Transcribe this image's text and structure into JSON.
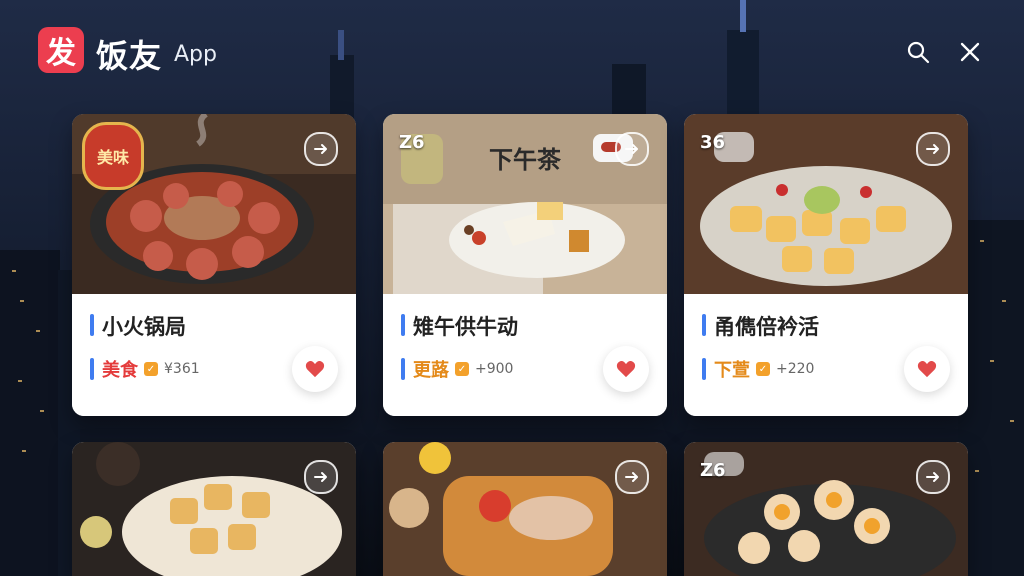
{
  "app": {
    "brand_badge": "发",
    "brand_name": "饭友",
    "brand_suffix": "App",
    "topbar_icons": [
      "search-icon",
      "close-icon"
    ]
  },
  "cards": [
    {
      "title": "小火锅局",
      "tag": "美食",
      "count": "¥361",
      "corner_label": "",
      "image_text": "美味",
      "overlay_title": ""
    },
    {
      "title": "雉午供牛动",
      "tag": "更蕗",
      "count": "+900",
      "corner_label": "Z6",
      "image_text": "",
      "overlay_title": "下午茶"
    },
    {
      "title": "甬儁倍衿活",
      "tag": "下萱",
      "count": "+220",
      "corner_label": "36",
      "image_text": "",
      "overlay_title": ""
    },
    {
      "title": "",
      "tag": "",
      "count": "",
      "corner_label": "",
      "image_text": "",
      "overlay_title": ""
    },
    {
      "title": "",
      "tag": "",
      "count": "",
      "corner_label": "",
      "image_text": "",
      "overlay_title": ""
    },
    {
      "title": "",
      "tag": "",
      "count": "",
      "corner_label": "Z6",
      "image_text": "",
      "overlay_title": ""
    }
  ],
  "colors": {
    "brand_red": "#ec3e4f",
    "accent_blue": "#3f7cf0",
    "heart_red": "#e24a4a",
    "tag_red": "#e43b3b",
    "tag_orange": "#e48a1a"
  }
}
